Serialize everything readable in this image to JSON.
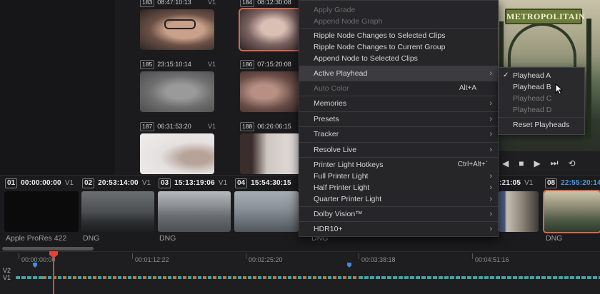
{
  "lightbox": {
    "clips": [
      {
        "num": "183",
        "tc": "08:47:10:13",
        "track": "V1"
      },
      {
        "num": "184",
        "tc": "08:12:30:08",
        "track": "V1"
      },
      {
        "num": "185",
        "tc": "23:15:10:14",
        "track": "V1"
      },
      {
        "num": "186",
        "tc": "07:15:20:08",
        "track": "V1"
      },
      {
        "num": "187",
        "tc": "06:31:53:20",
        "track": "V1"
      },
      {
        "num": "188",
        "tc": "06:26:06:15",
        "track": "V1"
      }
    ]
  },
  "viewer": {
    "sign_text": "METROPOLITAIN"
  },
  "context_menu": {
    "items": [
      {
        "label": "Apply Grade",
        "disabled": true
      },
      {
        "label": "Append Node Graph",
        "disabled": true
      },
      {
        "label": "Ripple Node Changes to Selected Clips"
      },
      {
        "label": "Ripple Node Changes to Current Group"
      },
      {
        "label": "Append Node to Selected Clips"
      },
      {
        "label": "Active Playhead",
        "submenu": true,
        "active": true
      },
      {
        "label": "Auto Color",
        "shortcut": "Alt+A"
      },
      {
        "label": "Memories",
        "submenu": true
      },
      {
        "label": "Presets",
        "submenu": true
      },
      {
        "label": "Tracker",
        "submenu": true
      },
      {
        "label": "Resolve Live",
        "submenu": true
      },
      {
        "label": "Printer Light Hotkeys",
        "shortcut": "Ctrl+Alt+`"
      },
      {
        "label": "Full Printer Light",
        "submenu": true
      },
      {
        "label": "Half Printer Light",
        "submenu": true
      },
      {
        "label": "Quarter Printer Light",
        "submenu": true
      },
      {
        "label": "Dolby Vision™",
        "submenu": true
      },
      {
        "label": "HDR10+",
        "submenu": true
      }
    ]
  },
  "submenu": {
    "items": [
      {
        "label": "Playhead A",
        "checked": true
      },
      {
        "label": "Playhead B"
      },
      {
        "label": "Playhead C",
        "disabled": true
      },
      {
        "label": "Playhead D",
        "disabled": true
      },
      {
        "label": "Reset Playheads"
      }
    ]
  },
  "clip_strip": {
    "clips": [
      {
        "num": "01",
        "tc": "00:00:00:00",
        "track": "V1",
        "codec": "Apple ProRes 422"
      },
      {
        "num": "02",
        "tc": "20:53:14:00",
        "track": "V1",
        "codec": "DNG"
      },
      {
        "num": "03",
        "tc": "15:13:19:06",
        "track": "V1",
        "codec": "DNG"
      },
      {
        "num": "04",
        "tc": "15:54:30:15",
        "track": "",
        "codec": "DNG"
      },
      {
        "num": "",
        "tc": "",
        "track": "",
        "codec": ""
      },
      {
        "num": "",
        "tc": ":21:05",
        "track": "V1",
        "codec": ""
      },
      {
        "num": "08",
        "tc": "22:55:20:14",
        "track": "",
        "codec": "DNG"
      }
    ]
  },
  "timeline": {
    "marks": [
      "00:00:00:00",
      "00:01:12:22",
      "00:02:25:20",
      "00:03:38:18",
      "00:04:51:16"
    ],
    "tracks": [
      "V2",
      "V1"
    ]
  },
  "transport": {
    "icons": [
      "rewind-icon",
      "stop-icon",
      "play-icon",
      "skip-forward-icon",
      "loop-icon"
    ]
  },
  "colors": {
    "accent_selection": "#d9654a",
    "playhead": "#e5433a",
    "timecode_blue": "#4a9be0",
    "clip_teal": "#3aa6a8",
    "clip_orange": "#c07a2c"
  }
}
